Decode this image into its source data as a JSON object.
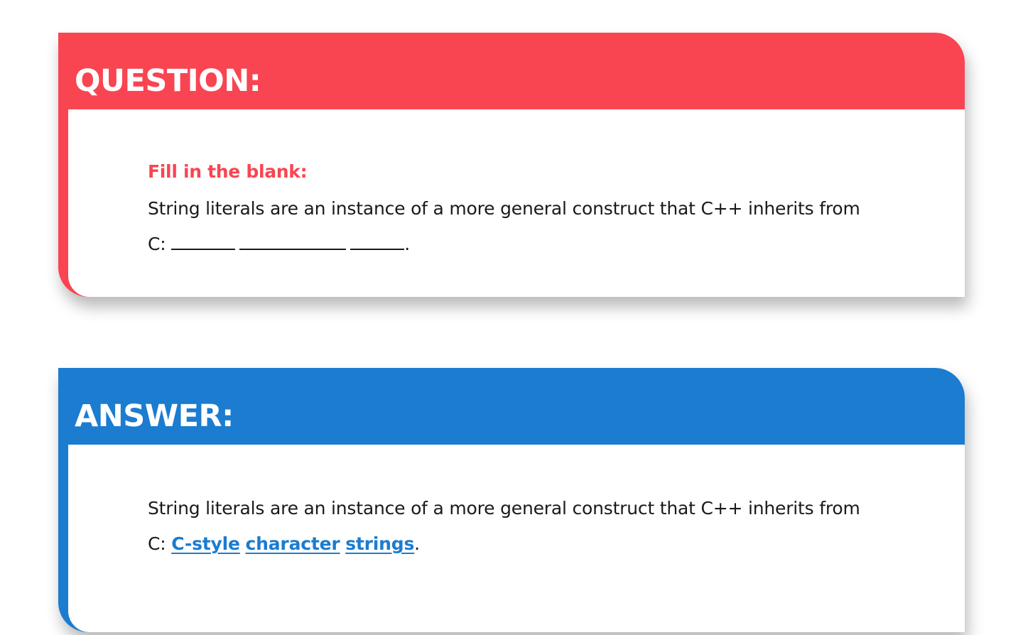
{
  "question": {
    "title": "QUESTION:",
    "prompt": "Fill in the blank:",
    "text": "String literals are an instance of a more general construct that C++ inherits from C:",
    "end": "."
  },
  "answer": {
    "title": "ANSWER:",
    "text": "String literals are an instance of a more general construct that C++ inherits from C:",
    "blanks": [
      "C-style",
      "character",
      "strings"
    ],
    "end": "."
  },
  "colors": {
    "question_accent": "#f94551",
    "answer_accent": "#1b7cd0"
  }
}
